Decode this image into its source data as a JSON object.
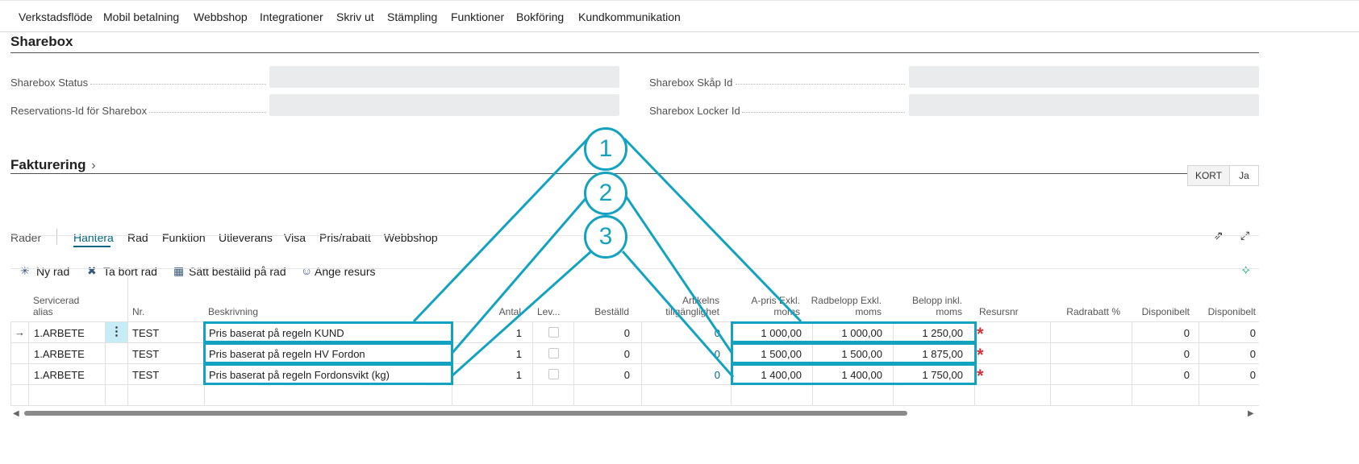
{
  "top_nav": [
    "Verkstadsflöde",
    "Mobil betalning",
    "Webbshop",
    "Integrationer",
    "Skriv ut",
    "Stämpling",
    "Funktioner",
    "Bokföring",
    "Kundkommunikation"
  ],
  "sharebox": {
    "title": "Sharebox",
    "status_label": "Sharebox Status",
    "reservation_label": "Reservations-Id för Sharebox",
    "skap_label": "Sharebox Skåp Id",
    "locker_label": "Sharebox Locker Id",
    "status_value": "",
    "reservation_value": "",
    "skap_value": "",
    "locker_value": ""
  },
  "fakturering": {
    "title": "Fakturering",
    "chevron": "chevron-right-icon",
    "kort_label": "KORT",
    "ja_label": "Ja"
  },
  "lines": {
    "title": "Rader",
    "tabs": [
      "Hantera",
      "Rad",
      "Funktion",
      "Utleverans",
      "Visa",
      "Pris/rabatt",
      "Webbshop"
    ],
    "active_tab": "Hantera",
    "actions": {
      "new_row": "Ny rad",
      "delete_row": "Ta bort rad",
      "set_ordered": "Sätt beställd på rad",
      "set_resource": "Ange resurs"
    },
    "columns": {
      "alias_1": "Servicerad",
      "alias_2": "alias",
      "nr": "Nr.",
      "beskrivning": "Beskrivning",
      "antal": "Antal",
      "lev": "Lev...",
      "bestalld": "Beställd",
      "tillg_1": "Artikelns",
      "tillg_2": "tillgänglighet",
      "apris_1": "A-pris Exkl.",
      "apris_2": "moms",
      "radbelopp_1": "Radbelopp Exkl.",
      "radbelopp_2": "moms",
      "belopp_1": "Belopp inkl.",
      "belopp_2": "moms",
      "resursnr": "Resursnr",
      "radrabatt": "Radrabatt %",
      "disp1": "Disponibelt",
      "disp2": "Disponibelt"
    },
    "rows": [
      {
        "alias": "1.ARBETE",
        "nr": "TEST",
        "beskrivning": "Pris baserat på regeln KUND",
        "antal": "1",
        "bestalld": "0",
        "tillg": "0",
        "apris": "1 000,00",
        "radbelopp": "1 000,00",
        "belopp": "1 250,00",
        "disp1": "0",
        "disp2": "0"
      },
      {
        "alias": "1.ARBETE",
        "nr": "TEST",
        "beskrivning": "Pris baserat på regeln HV Fordon",
        "antal": "1",
        "bestalld": "0",
        "tillg": "0",
        "apris": "1 500,00",
        "radbelopp": "1 500,00",
        "belopp": "1 875,00",
        "disp1": "0",
        "disp2": "0"
      },
      {
        "alias": "1.ARBETE",
        "nr": "TEST",
        "beskrivning": "Pris baserat på regeln Fordonsvikt (kg)",
        "antal": "1",
        "bestalld": "0",
        "tillg": "0",
        "apris": "1 400,00",
        "radbelopp": "1 400,00",
        "belopp": "1 750,00",
        "disp1": "0",
        "disp2": "0"
      }
    ],
    "required_marker": "*"
  },
  "callouts": [
    "1",
    "2",
    "3"
  ],
  "colors": {
    "callout": "#13a3c1",
    "accent": "#00677f",
    "required": "#d13438"
  }
}
